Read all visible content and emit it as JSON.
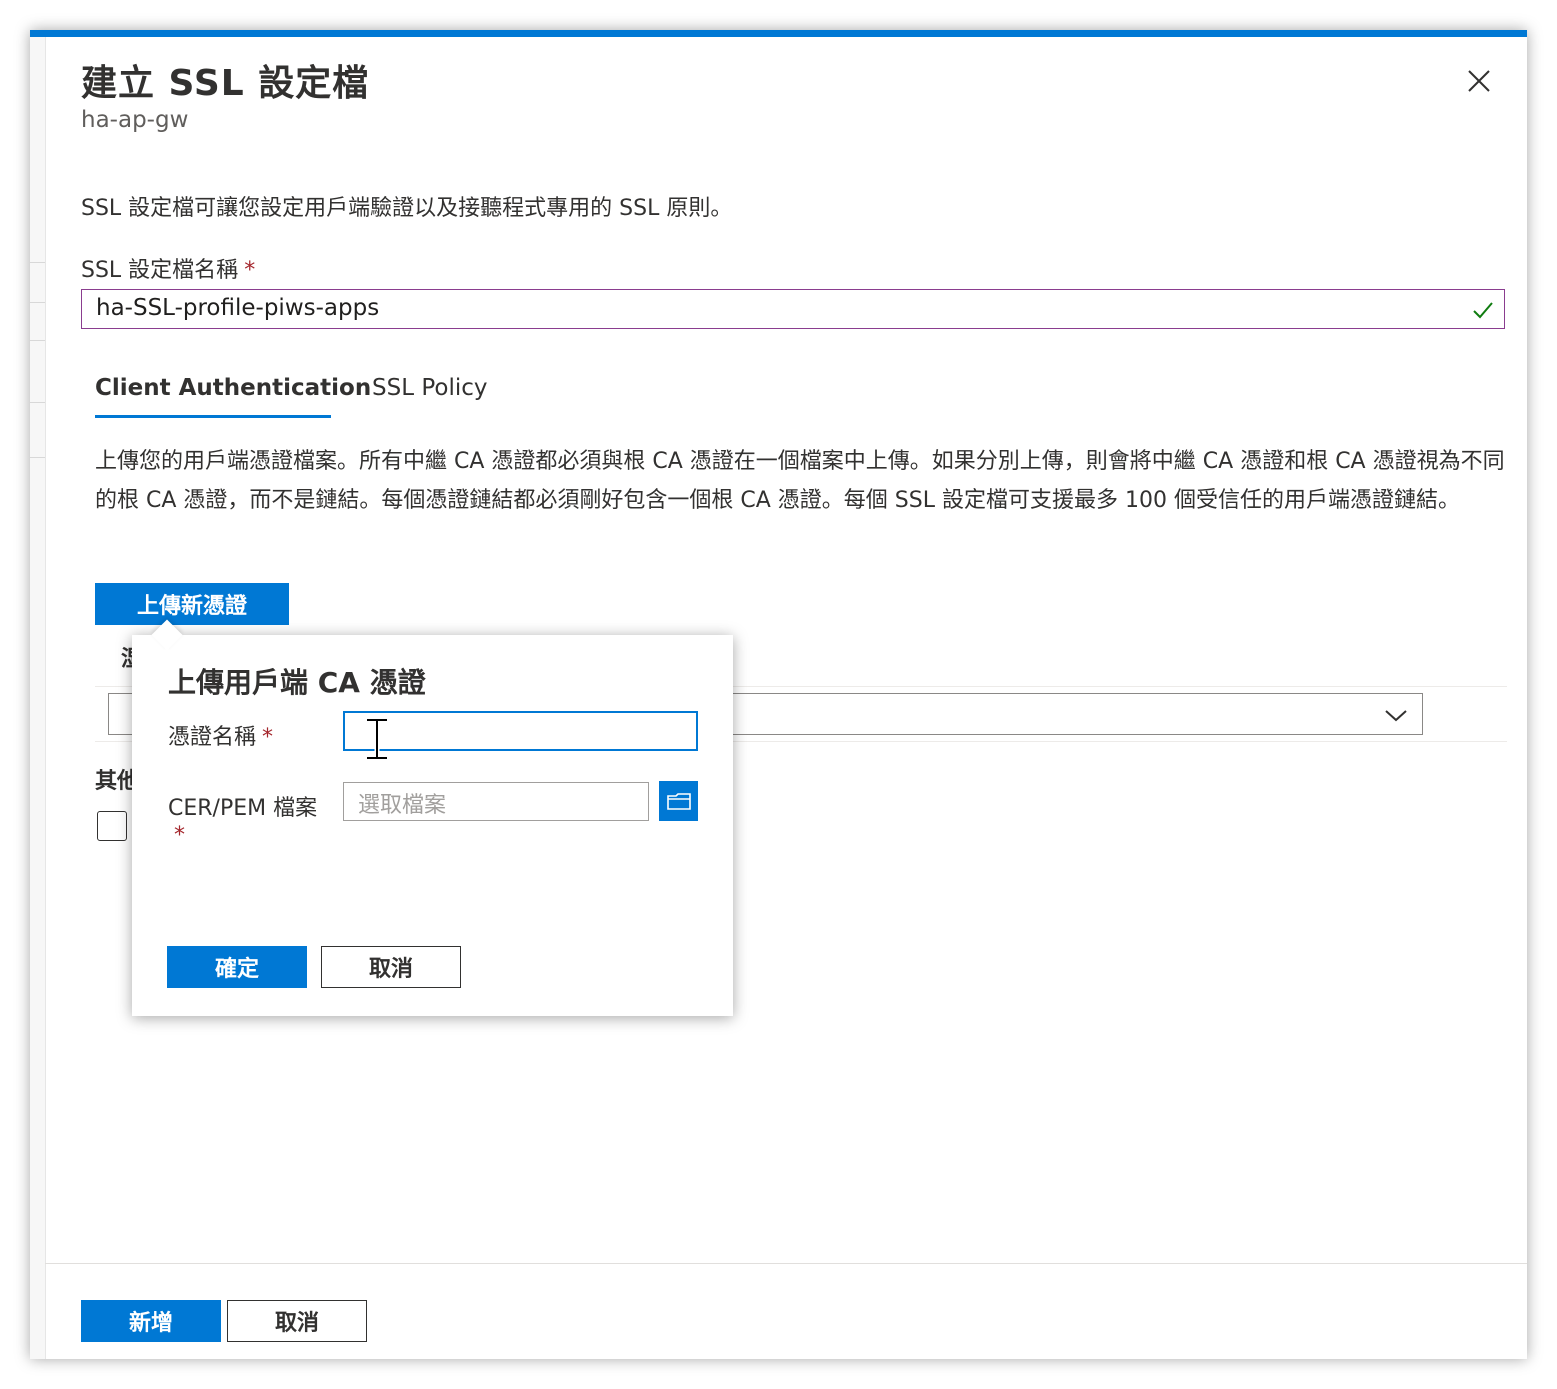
{
  "panel": {
    "title": "建立 SSL 設定檔",
    "subtitle": "ha-ap-gw",
    "intro": "SSL 設定檔可讓您設定用戶端驗證以及接聽程式專用的 SSL 原則。"
  },
  "profile_name": {
    "label": "SSL 設定檔名稱",
    "required_mark": "*",
    "value": "ha-SSL-profile-piws-apps"
  },
  "tabs": [
    {
      "label": "Client Authentication",
      "active": true
    },
    {
      "label": "SSL Policy",
      "active": false
    }
  ],
  "client_auth": {
    "description": "上傳您的用戶端憑證檔案。所有中繼 CA 憑證都必須與根 CA 憑證在一個檔案中上傳。如果分別上傳，則會將中繼 CA 憑證和根 CA 憑證視為不同的根 CA 憑證，而不是鏈結。每個憑證鏈結都必須剛好包含一個根 CA 憑證。每個 SSL 設定檔可支援最多 100 個受信任的用戶端憑證鏈結。",
    "upload_button": "上傳新憑證",
    "partial_col_char": "湿",
    "partial_other_char": "其他"
  },
  "callout": {
    "title": "上傳用戶端 CA 憑證",
    "cert_name_label": "憑證名稱",
    "cert_name_value": "",
    "file_label": "CER/PEM 檔案",
    "file_placeholder": "選取檔案",
    "required_mark": "*",
    "ok_button": "確定",
    "cancel_button": "取消"
  },
  "footer": {
    "add_button": "新增",
    "cancel_button": "取消"
  },
  "colors": {
    "accent": "#0078d4",
    "required": "#a4262c",
    "valid_check": "#107c10"
  }
}
